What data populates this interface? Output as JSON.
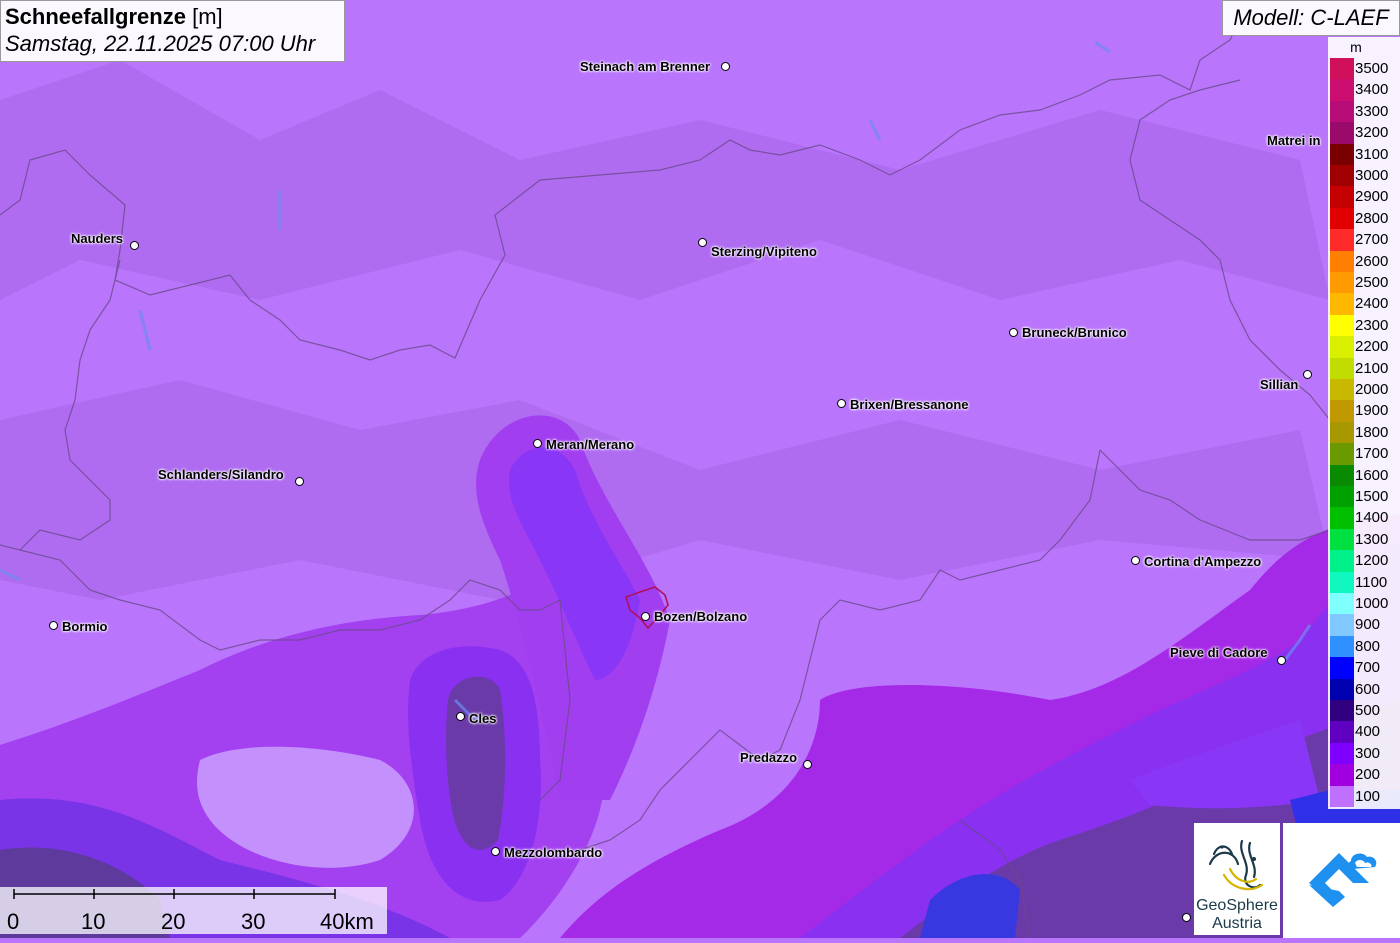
{
  "header": {
    "title": "Schneefallgrenze",
    "unit": "[m]",
    "datetime": "Samstag, 22.11.2025 07:00 Uhr"
  },
  "model_label": "Modell: C-LAEF",
  "legend": {
    "unit": "m",
    "levels": [
      {
        "label": "3500",
        "color": "#d0105a"
      },
      {
        "label": "3400",
        "color": "#cc0e70"
      },
      {
        "label": "3300",
        "color": "#b80c78"
      },
      {
        "label": "3200",
        "color": "#9a0a6a"
      },
      {
        "label": "3100",
        "color": "#7a0000"
      },
      {
        "label": "3000",
        "color": "#a00000"
      },
      {
        "label": "2900",
        "color": "#c40000"
      },
      {
        "label": "2800",
        "color": "#e00000"
      },
      {
        "label": "2700",
        "color": "#ff2a2a"
      },
      {
        "label": "2600",
        "color": "#ff8000"
      },
      {
        "label": "2500",
        "color": "#ff9a00"
      },
      {
        "label": "2400",
        "color": "#ffb800"
      },
      {
        "label": "2300",
        "color": "#ffff00"
      },
      {
        "label": "2200",
        "color": "#d8f000"
      },
      {
        "label": "2100",
        "color": "#c0dc00"
      },
      {
        "label": "2000",
        "color": "#c8b800"
      },
      {
        "label": "1900",
        "color": "#c09800"
      },
      {
        "label": "1800",
        "color": "#a89800"
      },
      {
        "label": "1700",
        "color": "#6a9a00"
      },
      {
        "label": "1600",
        "color": "#0a8a00"
      },
      {
        "label": "1500",
        "color": "#00a000"
      },
      {
        "label": "1400",
        "color": "#00c000"
      },
      {
        "label": "1300",
        "color": "#00e040"
      },
      {
        "label": "1200",
        "color": "#00f08a"
      },
      {
        "label": "1100",
        "color": "#10f8c0"
      },
      {
        "label": "1000",
        "color": "#80ffff"
      },
      {
        "label": "900",
        "color": "#80c8ff"
      },
      {
        "label": "800",
        "color": "#3090ff"
      },
      {
        "label": "700",
        "color": "#0000ff"
      },
      {
        "label": "600",
        "color": "#0000b0"
      },
      {
        "label": "500",
        "color": "#300080"
      },
      {
        "label": "400",
        "color": "#6000c0"
      },
      {
        "label": "300",
        "color": "#8000ff"
      },
      {
        "label": "200",
        "color": "#a000e0"
      },
      {
        "label": "100",
        "color": "#c070ff"
      }
    ]
  },
  "cities": [
    {
      "name": "Steinach am Brenner"
    },
    {
      "name": "Matrei in"
    },
    {
      "name": "Nauders"
    },
    {
      "name": "Sterzing/Vipiteno"
    },
    {
      "name": "Bruneck/Brunico"
    },
    {
      "name": "Sillian"
    },
    {
      "name": "Brixen/Bressanone"
    },
    {
      "name": "Meran/Merano"
    },
    {
      "name": "Schlanders/Silandro"
    },
    {
      "name": "Cortina d'Ampezzo"
    },
    {
      "name": "Bormio"
    },
    {
      "name": "Bozen/Bolzano"
    },
    {
      "name": "Pieve di Cadore"
    },
    {
      "name": "Cles"
    },
    {
      "name": "Predazzo"
    },
    {
      "name": "Mezzolombardo"
    }
  ],
  "scale_bar": {
    "ticks": [
      "0",
      "10",
      "20",
      "30",
      "40km"
    ]
  },
  "logos": {
    "geosphere_line1": "GeoSphere",
    "geosphere_line2": "Austria"
  },
  "colors": {
    "base": "#b975fb",
    "low_snowline": "#9a3af5",
    "magenta": "#a52ae8",
    "blue": "#7a2cf2",
    "dark": "#5a3a9a",
    "light": "#c490fc"
  }
}
